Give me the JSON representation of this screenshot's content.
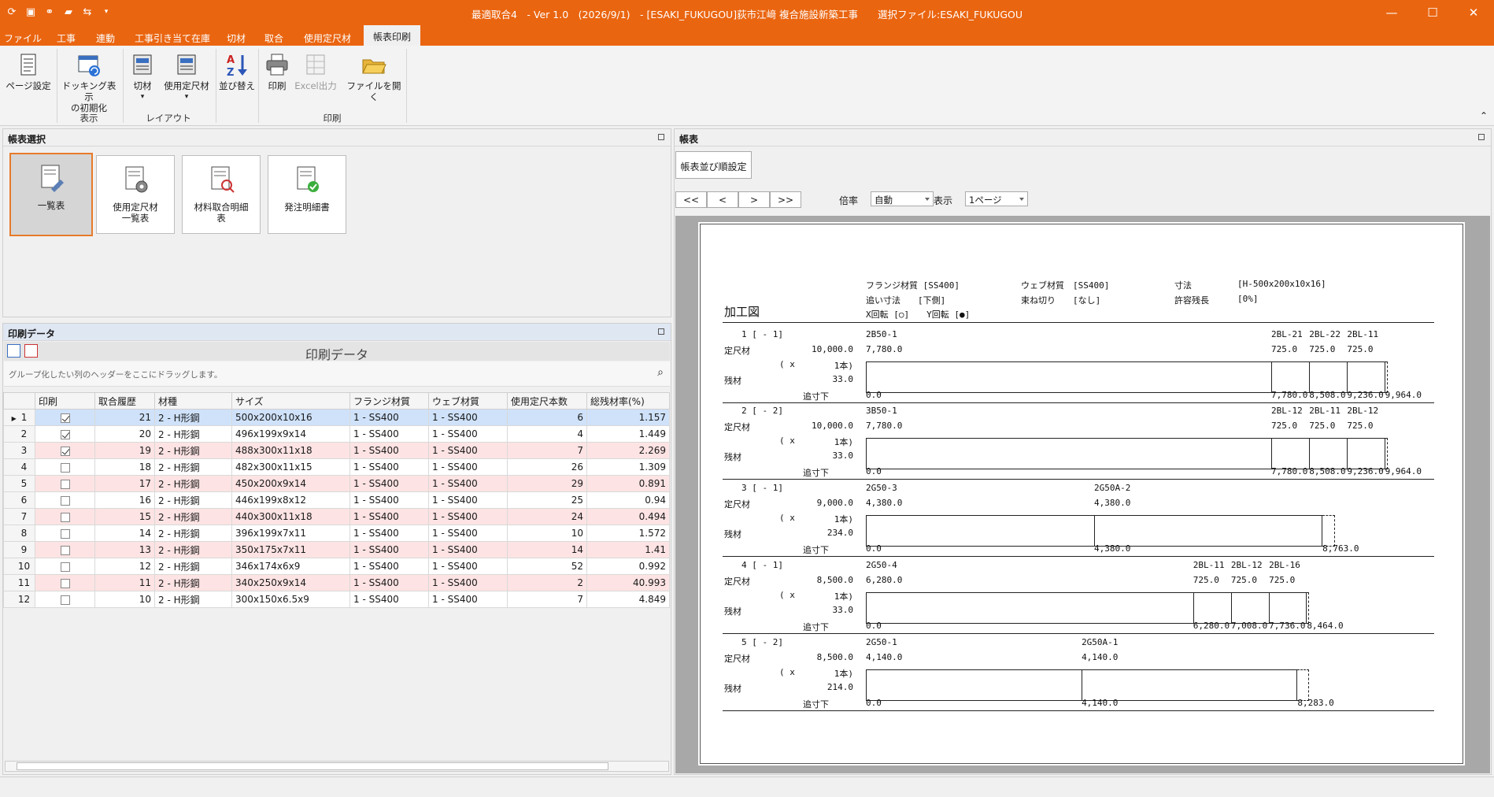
{
  "window": {
    "title": "最適取合4　- Ver 1.0　(2026/9/1)　- [ESAKI_FUKUGOU]荻市江﨑 複合施設新築工事　　選択ファイル:ESAKI_FUKUGOU",
    "controls": {
      "minimize": "—",
      "maximize": "☐",
      "close": "✕"
    }
  },
  "qat": [
    "gear-icon",
    "save-icon",
    "binoculars-icon",
    "folder-icon",
    "sync-icon",
    "dropdown-icon"
  ],
  "tabs": [
    {
      "label": "ファイル"
    },
    {
      "label": "工事"
    },
    {
      "label": "連動"
    },
    {
      "label": "工事引き当て在庫"
    },
    {
      "label": "切材"
    },
    {
      "label": "取合"
    },
    {
      "label": "使用定尺材"
    },
    {
      "label": "帳表印刷"
    }
  ],
  "ribbon": {
    "page_setup": "ページ設定",
    "docking_reset_1": "ドッキング表示",
    "docking_reset_2": "の初期化",
    "cut": "切材",
    "std_material": "使用定尺材",
    "sort": "並び替え",
    "print": "印刷",
    "excel": "Excel出力",
    "open_file": "ファイルを開く",
    "groups": {
      "display": "表示",
      "layout": "レイアウト",
      "print": "印刷"
    }
  },
  "report_select": {
    "title": "帳表選択",
    "tiles": [
      {
        "label": "一覧表"
      },
      {
        "label": "使用定尺材\n一覧表"
      },
      {
        "label": "材料取合明細\n表"
      },
      {
        "label": "発注明細書"
      }
    ]
  },
  "print_data": {
    "title": "印刷データ",
    "grid_title": "印刷データ",
    "group_hint": "グループ化したい列のヘッダーをここにドラッグします。",
    "columns": [
      "印刷",
      "取合履歴",
      "材種",
      "サイズ",
      "フランジ材質",
      "ウェブ材質",
      "使用定尺本数",
      "総残材率(%)"
    ],
    "rows": [
      {
        "n": "1",
        "p": true,
        "h": "21",
        "k": "2 - H形鋼",
        "s": "500x200x10x16",
        "f": "1 - SS400",
        "w": "1 - SS400",
        "c": "6",
        "r": "1.157"
      },
      {
        "n": "2",
        "p": true,
        "h": "20",
        "k": "2 - H形鋼",
        "s": "496x199x9x14",
        "f": "1 - SS400",
        "w": "1 - SS400",
        "c": "4",
        "r": "1.449"
      },
      {
        "n": "3",
        "p": true,
        "h": "19",
        "k": "2 - H形鋼",
        "s": "488x300x11x18",
        "f": "1 - SS400",
        "w": "1 - SS400",
        "c": "7",
        "r": "2.269"
      },
      {
        "n": "4",
        "p": false,
        "h": "18",
        "k": "2 - H形鋼",
        "s": "482x300x11x15",
        "f": "1 - SS400",
        "w": "1 - SS400",
        "c": "26",
        "r": "1.309"
      },
      {
        "n": "5",
        "p": false,
        "h": "17",
        "k": "2 - H形鋼",
        "s": "450x200x9x14",
        "f": "1 - SS400",
        "w": "1 - SS400",
        "c": "29",
        "r": "0.891"
      },
      {
        "n": "6",
        "p": false,
        "h": "16",
        "k": "2 - H形鋼",
        "s": "446x199x8x12",
        "f": "1 - SS400",
        "w": "1 - SS400",
        "c": "25",
        "r": "0.94"
      },
      {
        "n": "7",
        "p": false,
        "h": "15",
        "k": "2 - H形鋼",
        "s": "440x300x11x18",
        "f": "1 - SS400",
        "w": "1 - SS400",
        "c": "24",
        "r": "0.494"
      },
      {
        "n": "8",
        "p": false,
        "h": "14",
        "k": "2 - H形鋼",
        "s": "396x199x7x11",
        "f": "1 - SS400",
        "w": "1 - SS400",
        "c": "10",
        "r": "1.572"
      },
      {
        "n": "9",
        "p": false,
        "h": "13",
        "k": "2 - H形鋼",
        "s": "350x175x7x11",
        "f": "1 - SS400",
        "w": "1 - SS400",
        "c": "14",
        "r": "1.41"
      },
      {
        "n": "10",
        "p": false,
        "h": "12",
        "k": "2 - H形鋼",
        "s": "346x174x6x9",
        "f": "1 - SS400",
        "w": "1 - SS400",
        "c": "52",
        "r": "0.992"
      },
      {
        "n": "11",
        "p": false,
        "h": "11",
        "k": "2 - H形鋼",
        "s": "340x250x9x14",
        "f": "1 - SS400",
        "w": "1 - SS400",
        "c": "2",
        "r": "40.993"
      },
      {
        "n": "12",
        "p": false,
        "h": "10",
        "k": "2 - H形鋼",
        "s": "300x150x6.5x9",
        "f": "1 - SS400",
        "w": "1 - SS400",
        "c": "7",
        "r": "4.849"
      }
    ]
  },
  "report_view": {
    "title": "帳表",
    "order_btn": "帳表並び順設定",
    "nav": [
      "<<",
      "<",
      ">",
      ">>"
    ],
    "zoom_label": "倍率",
    "zoom_value": "自動",
    "view_label": "表示",
    "view_value": "1ページ"
  },
  "sheet": {
    "heading": "加工図",
    "hdr": {
      "flange": "フランジ材質 [SS400]",
      "web": "ウェブ材質　[SS400]",
      "size_l": "寸法",
      "size_v": "[H-500x200x10x16]",
      "oi_l": "追い寸法　　[下側]",
      "tabane": "束ね切り　　[なし]",
      "kyoyo_l": "許容残長",
      "kyoyo_v": "[0%]",
      "rot": "X回転 [○]　　Y回転 [●]"
    },
    "labels": {
      "std": "定尺材",
      "x": "( x",
      "rem": "残材",
      "oi": "追寸下"
    },
    "blocks": [
      {
        "id": "1 [ - 1]",
        "std": "10,000.0",
        "qty": "1本)",
        "rem": "33.0",
        "names": [
          "2B50-1",
          "2BL-21",
          "2BL-22",
          "2BL-11"
        ],
        "lens": [
          "7,780.0",
          "725.0",
          "725.0",
          "725.0"
        ],
        "oi": [
          "0.0",
          "7,780.0",
          "8,508.0",
          "9,236.0",
          "9,964.0"
        ]
      },
      {
        "id": "2 [ - 2]",
        "std": "10,000.0",
        "qty": "1本)",
        "rem": "33.0",
        "names": [
          "3B50-1",
          "2BL-12",
          "2BL-11",
          "2BL-12"
        ],
        "lens": [
          "7,780.0",
          "725.0",
          "725.0",
          "725.0"
        ],
        "oi": [
          "0.0",
          "7,780.0",
          "8,508.0",
          "9,236.0",
          "9,964.0"
        ]
      },
      {
        "id": "3 [ - 1]",
        "std": "9,000.0",
        "qty": "1本)",
        "rem": "234.0",
        "names": [
          "2G50-3",
          "2G50A-2"
        ],
        "lens": [
          "4,380.0",
          "4,380.0"
        ],
        "oi": [
          "0.0",
          "4,380.0",
          "8,763.0"
        ]
      },
      {
        "id": "4 [ - 1]",
        "std": "8,500.0",
        "qty": "1本)",
        "rem": "33.0",
        "names": [
          "2G50-4",
          "2BL-11",
          "2BL-12",
          "2BL-16"
        ],
        "lens": [
          "6,280.0",
          "725.0",
          "725.0",
          "725.0"
        ],
        "oi": [
          "0.0",
          "6,280.0",
          "7,008.0",
          "7,736.0",
          "8,464.0"
        ]
      },
      {
        "id": "5 [ - 2]",
        "std": "8,500.0",
        "qty": "1本)",
        "rem": "214.0",
        "names": [
          "2G50-1",
          "2G50A-1"
        ],
        "lens": [
          "4,140.0",
          "4,140.0"
        ],
        "oi": [
          "0.0",
          "4,140.0",
          "8,283.0"
        ]
      }
    ]
  },
  "colors": {
    "accent": "#ea6510",
    "selected_tile_border": "#e77a2a",
    "pink_row": "#fde3e3"
  }
}
